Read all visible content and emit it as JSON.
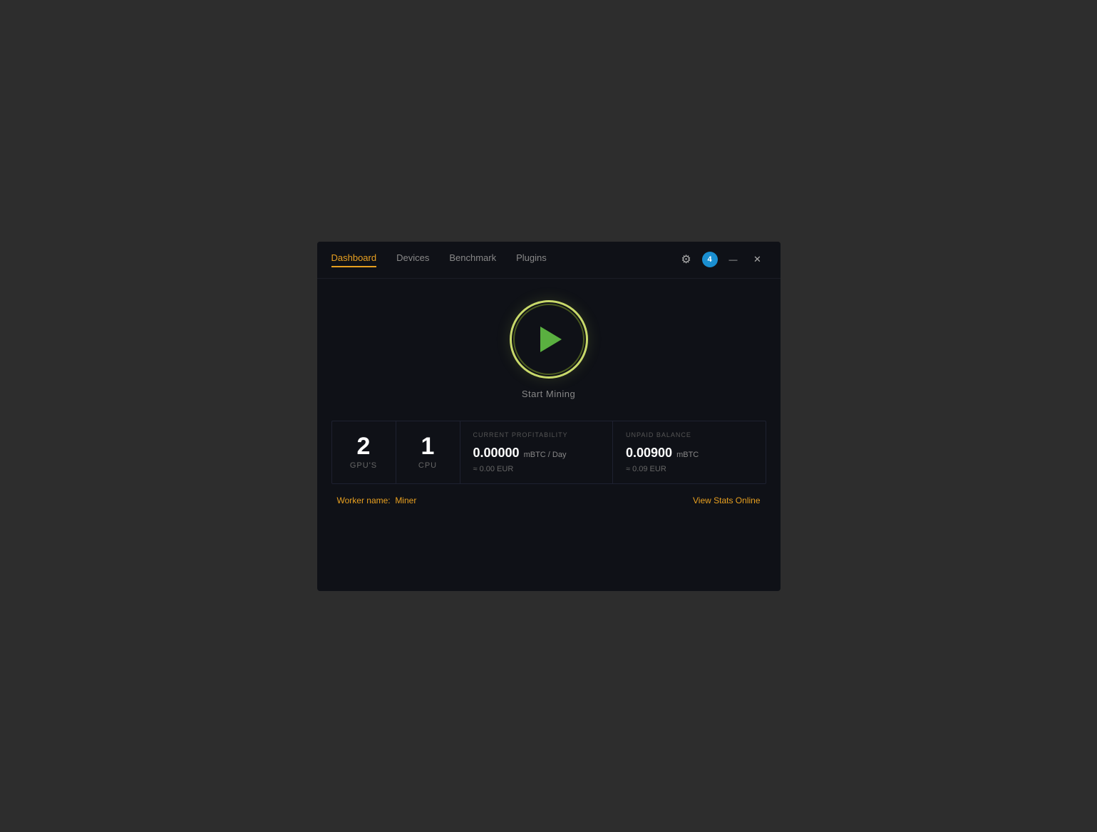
{
  "nav": {
    "tabs": [
      {
        "id": "dashboard",
        "label": "Dashboard",
        "active": true
      },
      {
        "id": "devices",
        "label": "Devices",
        "active": false
      },
      {
        "id": "benchmark",
        "label": "Benchmark",
        "active": false
      },
      {
        "id": "plugins",
        "label": "Plugins",
        "active": false
      }
    ],
    "notification_count": "4"
  },
  "mining": {
    "play_button_label": "Start Mining"
  },
  "stats": {
    "gpus": {
      "count": "2",
      "label": "GPU'S"
    },
    "cpu": {
      "count": "1",
      "label": "CPU"
    },
    "profitability": {
      "section_label": "CURRENT PROFITABILITY",
      "value": "0.00000",
      "unit": "mBTC / Day",
      "sub": "≈ 0.00 EUR"
    },
    "balance": {
      "section_label": "UNPAID BALANCE",
      "value": "0.00900",
      "unit": "mBTC",
      "sub": "≈ 0.09 EUR"
    }
  },
  "footer": {
    "worker_label": "Worker name:",
    "worker_value": "Miner",
    "view_stats_label": "View Stats Online"
  }
}
